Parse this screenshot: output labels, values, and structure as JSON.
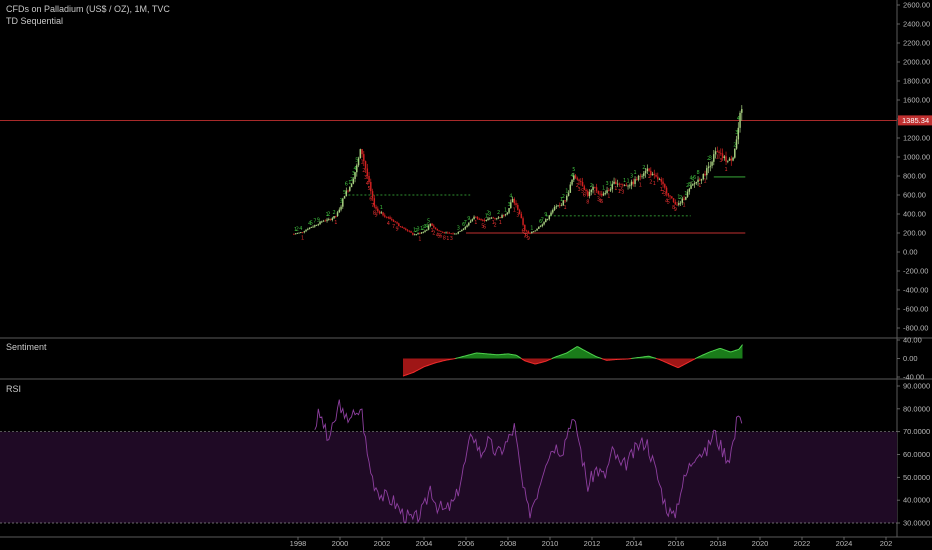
{
  "main_pane": {
    "title": "CFDs on Palladium (US$ / OZ), 1M, TVC",
    "indicator": "TD Sequential",
    "current_price_label": "1385.34",
    "y_ticks": [
      "2600.00",
      "2400.00",
      "2200.00",
      "2000.00",
      "1800.00",
      "1600.00",
      "1400.00",
      "1200.00",
      "1000.00",
      "800.00",
      "600.00",
      "400.00",
      "200.00",
      "0.00",
      "-200.00",
      "-400.00",
      "-600.00",
      "-800.00"
    ]
  },
  "sentiment_pane": {
    "title": "Sentiment",
    "y_ticks": [
      "40.00",
      "0.00",
      "-40.00"
    ]
  },
  "rsi_pane": {
    "title": "RSI",
    "y_ticks": [
      "90.0000",
      "80.0000",
      "70.0000",
      "60.0000",
      "50.0000",
      "40.0000",
      "30.0000"
    ]
  },
  "x_axis": {
    "ticks": [
      "1998",
      "2000",
      "2002",
      "2004",
      "2006",
      "2008",
      "2010",
      "2012",
      "2014",
      "2016",
      "2018",
      "2020",
      "2022",
      "2024",
      "202"
    ]
  },
  "colors": {
    "background": "#000000",
    "up_candle": "#a8d080",
    "down_candle": "#d02020",
    "td_green": "#3fbf3f",
    "td_red": "#e03030",
    "price_line": "#c03030",
    "rsi_line": "#8e3fa0",
    "rsi_band": "#1f0a25",
    "sentiment_pos": "#1d8a1d",
    "sentiment_neg": "#b01818"
  },
  "chart_data": [
    {
      "type": "candlestick",
      "title": "CFDs on Palladium (US$ / OZ), 1M, TVC",
      "ylim": [
        -850,
        2650
      ],
      "current_price": 1385.34,
      "price_series_close": [
        {
          "x": 1997.8,
          "y": 190
        },
        {
          "x": 1998.2,
          "y": 210
        },
        {
          "x": 1998.5,
          "y": 250
        },
        {
          "x": 1998.8,
          "y": 280
        },
        {
          "x": 1999.2,
          "y": 330
        },
        {
          "x": 1999.5,
          "y": 340
        },
        {
          "x": 1999.8,
          "y": 380
        },
        {
          "x": 2000.0,
          "y": 450
        },
        {
          "x": 2000.2,
          "y": 600
        },
        {
          "x": 2000.5,
          "y": 700
        },
        {
          "x": 2000.8,
          "y": 900
        },
        {
          "x": 2001.0,
          "y": 1090
        },
        {
          "x": 2001.2,
          "y": 900
        },
        {
          "x": 2001.4,
          "y": 700
        },
        {
          "x": 2001.6,
          "y": 500
        },
        {
          "x": 2001.8,
          "y": 430
        },
        {
          "x": 2002.0,
          "y": 400
        },
        {
          "x": 2002.3,
          "y": 360
        },
        {
          "x": 2002.6,
          "y": 320
        },
        {
          "x": 2002.9,
          "y": 260
        },
        {
          "x": 2003.2,
          "y": 230
        },
        {
          "x": 2003.5,
          "y": 180
        },
        {
          "x": 2003.8,
          "y": 200
        },
        {
          "x": 2004.1,
          "y": 230
        },
        {
          "x": 2004.3,
          "y": 300
        },
        {
          "x": 2004.6,
          "y": 230
        },
        {
          "x": 2005.0,
          "y": 200
        },
        {
          "x": 2005.5,
          "y": 190
        },
        {
          "x": 2006.0,
          "y": 270
        },
        {
          "x": 2006.4,
          "y": 370
        },
        {
          "x": 2006.8,
          "y": 330
        },
        {
          "x": 2007.2,
          "y": 360
        },
        {
          "x": 2007.6,
          "y": 360
        },
        {
          "x": 2008.0,
          "y": 430
        },
        {
          "x": 2008.2,
          "y": 560
        },
        {
          "x": 2008.5,
          "y": 440
        },
        {
          "x": 2008.8,
          "y": 230
        },
        {
          "x": 2009.0,
          "y": 190
        },
        {
          "x": 2009.3,
          "y": 230
        },
        {
          "x": 2009.6,
          "y": 290
        },
        {
          "x": 2009.9,
          "y": 360
        },
        {
          "x": 2010.2,
          "y": 460
        },
        {
          "x": 2010.5,
          "y": 490
        },
        {
          "x": 2010.8,
          "y": 580
        },
        {
          "x": 2011.1,
          "y": 790
        },
        {
          "x": 2011.4,
          "y": 770
        },
        {
          "x": 2011.8,
          "y": 600
        },
        {
          "x": 2012.1,
          "y": 680
        },
        {
          "x": 2012.4,
          "y": 600
        },
        {
          "x": 2012.8,
          "y": 650
        },
        {
          "x": 2013.1,
          "y": 740
        },
        {
          "x": 2013.5,
          "y": 700
        },
        {
          "x": 2013.9,
          "y": 720
        },
        {
          "x": 2014.2,
          "y": 780
        },
        {
          "x": 2014.6,
          "y": 880
        },
        {
          "x": 2014.9,
          "y": 800
        },
        {
          "x": 2015.2,
          "y": 760
        },
        {
          "x": 2015.6,
          "y": 620
        },
        {
          "x": 2015.9,
          "y": 520
        },
        {
          "x": 2016.1,
          "y": 500
        },
        {
          "x": 2016.4,
          "y": 570
        },
        {
          "x": 2016.7,
          "y": 680
        },
        {
          "x": 2017.0,
          "y": 750
        },
        {
          "x": 2017.3,
          "y": 800
        },
        {
          "x": 2017.6,
          "y": 920
        },
        {
          "x": 2017.9,
          "y": 1050
        },
        {
          "x": 2018.2,
          "y": 1000
        },
        {
          "x": 2018.5,
          "y": 950
        },
        {
          "x": 2018.7,
          "y": 1000
        },
        {
          "x": 2018.9,
          "y": 1200
        },
        {
          "x": 2019.0,
          "y": 1350
        },
        {
          "x": 2019.1,
          "y": 1500
        },
        {
          "x": 2019.2,
          "y": 1385
        }
      ],
      "horizontal_levels": [
        {
          "y": 1385.34,
          "x_start": 1990,
          "x_end": 2030,
          "style": "solid",
          "color": "#c03030"
        },
        {
          "y": 600,
          "x_start": 2000.4,
          "x_end": 2006.2,
          "style": "dashed",
          "color": "#3fbf3f"
        },
        {
          "y": 380,
          "x_start": 2009.8,
          "x_end": 2016.7,
          "style": "dashed",
          "color": "#3fbf3f"
        },
        {
          "y": 790,
          "x_start": 2017.8,
          "x_end": 2019.3,
          "style": "solid",
          "color": "#3fbf3f"
        },
        {
          "y": 200,
          "x_start": 2006.0,
          "x_end": 2019.3,
          "style": "solid",
          "color": "#c03030"
        }
      ]
    },
    {
      "type": "area",
      "title": "Sentiment",
      "ylim": [
        -40,
        40
      ],
      "series": [
        {
          "values": [
            {
              "x": 2003.0,
              "y": -38
            },
            {
              "x": 2003.5,
              "y": -30
            },
            {
              "x": 2004.0,
              "y": -18
            },
            {
              "x": 2004.5,
              "y": -10
            },
            {
              "x": 2005.0,
              "y": -4
            },
            {
              "x": 2005.5,
              "y": 0
            },
            {
              "x": 2006.0,
              "y": 6
            },
            {
              "x": 2006.5,
              "y": 12
            },
            {
              "x": 2007.0,
              "y": 10
            },
            {
              "x": 2007.5,
              "y": 8
            },
            {
              "x": 2008.0,
              "y": 10
            },
            {
              "x": 2008.4,
              "y": 7
            },
            {
              "x": 2008.8,
              "y": -5
            },
            {
              "x": 2009.3,
              "y": -12
            },
            {
              "x": 2009.8,
              "y": -6
            },
            {
              "x": 2010.3,
              "y": 4
            },
            {
              "x": 2010.8,
              "y": 12
            },
            {
              "x": 2011.3,
              "y": 26
            },
            {
              "x": 2011.7,
              "y": 16
            },
            {
              "x": 2012.2,
              "y": 4
            },
            {
              "x": 2012.7,
              "y": -4
            },
            {
              "x": 2013.2,
              "y": -2
            },
            {
              "x": 2013.7,
              "y": -1
            },
            {
              "x": 2014.2,
              "y": 2
            },
            {
              "x": 2014.7,
              "y": 5
            },
            {
              "x": 2015.2,
              "y": -2
            },
            {
              "x": 2015.7,
              "y": -12
            },
            {
              "x": 2016.1,
              "y": -20
            },
            {
              "x": 2016.6,
              "y": -8
            },
            {
              "x": 2017.1,
              "y": 4
            },
            {
              "x": 2017.6,
              "y": 14
            },
            {
              "x": 2018.1,
              "y": 22
            },
            {
              "x": 2018.6,
              "y": 14
            },
            {
              "x": 2019.0,
              "y": 20
            },
            {
              "x": 2019.2,
              "y": 32
            }
          ]
        }
      ]
    },
    {
      "type": "line",
      "title": "RSI",
      "ylim": [
        28,
        92
      ],
      "band": [
        30,
        70
      ],
      "series": [
        {
          "values": [
            {
              "x": 1998.8,
              "y": 72
            },
            {
              "x": 1999.0,
              "y": 78
            },
            {
              "x": 1999.2,
              "y": 74
            },
            {
              "x": 1999.4,
              "y": 66
            },
            {
              "x": 1999.7,
              "y": 72
            },
            {
              "x": 2000.0,
              "y": 84
            },
            {
              "x": 2000.2,
              "y": 74
            },
            {
              "x": 2000.5,
              "y": 78
            },
            {
              "x": 2000.8,
              "y": 76
            },
            {
              "x": 2001.0,
              "y": 82
            },
            {
              "x": 2001.3,
              "y": 60
            },
            {
              "x": 2001.6,
              "y": 48
            },
            {
              "x": 2002.0,
              "y": 42
            },
            {
              "x": 2002.5,
              "y": 40
            },
            {
              "x": 2003.0,
              "y": 34
            },
            {
              "x": 2003.5,
              "y": 31
            },
            {
              "x": 2004.0,
              "y": 36
            },
            {
              "x": 2004.3,
              "y": 46
            },
            {
              "x": 2004.6,
              "y": 38
            },
            {
              "x": 2005.0,
              "y": 35
            },
            {
              "x": 2005.5,
              "y": 40
            },
            {
              "x": 2006.0,
              "y": 58
            },
            {
              "x": 2006.3,
              "y": 70
            },
            {
              "x": 2006.7,
              "y": 60
            },
            {
              "x": 2007.0,
              "y": 66
            },
            {
              "x": 2007.5,
              "y": 60
            },
            {
              "x": 2008.0,
              "y": 66
            },
            {
              "x": 2008.3,
              "y": 72
            },
            {
              "x": 2008.7,
              "y": 46
            },
            {
              "x": 2009.0,
              "y": 34
            },
            {
              "x": 2009.4,
              "y": 44
            },
            {
              "x": 2009.8,
              "y": 58
            },
            {
              "x": 2010.2,
              "y": 64
            },
            {
              "x": 2010.6,
              "y": 62
            },
            {
              "x": 2011.0,
              "y": 76
            },
            {
              "x": 2011.3,
              "y": 70
            },
            {
              "x": 2011.8,
              "y": 46
            },
            {
              "x": 2012.2,
              "y": 54
            },
            {
              "x": 2012.6,
              "y": 50
            },
            {
              "x": 2013.0,
              "y": 62
            },
            {
              "x": 2013.4,
              "y": 54
            },
            {
              "x": 2013.8,
              "y": 58
            },
            {
              "x": 2014.2,
              "y": 64
            },
            {
              "x": 2014.6,
              "y": 66
            },
            {
              "x": 2015.0,
              "y": 54
            },
            {
              "x": 2015.5,
              "y": 38
            },
            {
              "x": 2015.9,
              "y": 32
            },
            {
              "x": 2016.2,
              "y": 44
            },
            {
              "x": 2016.6,
              "y": 54
            },
            {
              "x": 2017.0,
              "y": 62
            },
            {
              "x": 2017.4,
              "y": 60
            },
            {
              "x": 2017.8,
              "y": 70
            },
            {
              "x": 2018.1,
              "y": 64
            },
            {
              "x": 2018.5,
              "y": 58
            },
            {
              "x": 2018.8,
              "y": 68
            },
            {
              "x": 2019.0,
              "y": 82
            },
            {
              "x": 2019.2,
              "y": 70
            }
          ]
        }
      ]
    }
  ]
}
